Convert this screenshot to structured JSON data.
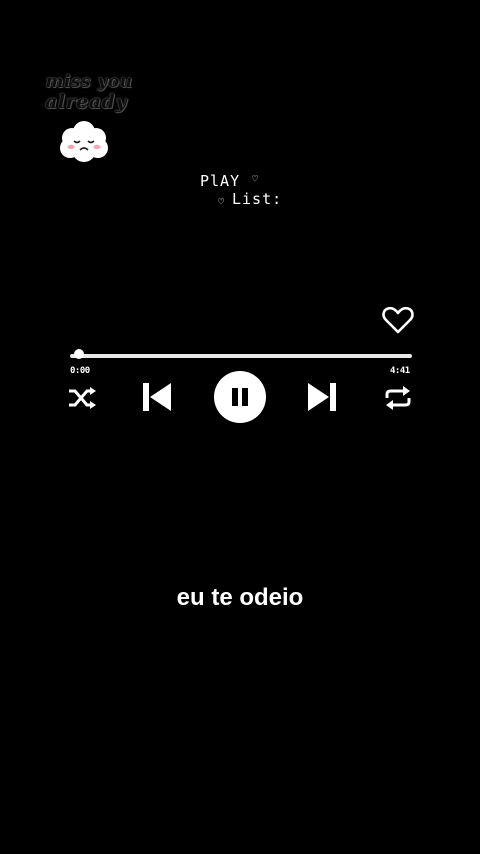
{
  "sticker": {
    "line1": "miss you",
    "line2": "already",
    "icon": "sad-cloud-icon"
  },
  "playlist_label": {
    "line1": "PlAY",
    "line2": "List:"
  },
  "player": {
    "favorite_icon": "heart-outline-icon",
    "progress": 0.02,
    "time_elapsed": "0:00",
    "time_total": "4:41",
    "controls": {
      "shuffle_icon": "shuffle-icon",
      "previous_icon": "skip-previous-icon",
      "play_pause_icon": "pause-icon",
      "next_icon": "skip-next-icon",
      "repeat_icon": "repeat-icon"
    }
  },
  "lyric": "eu te odeio",
  "colors": {
    "background": "#000000",
    "foreground": "#ffffff"
  }
}
